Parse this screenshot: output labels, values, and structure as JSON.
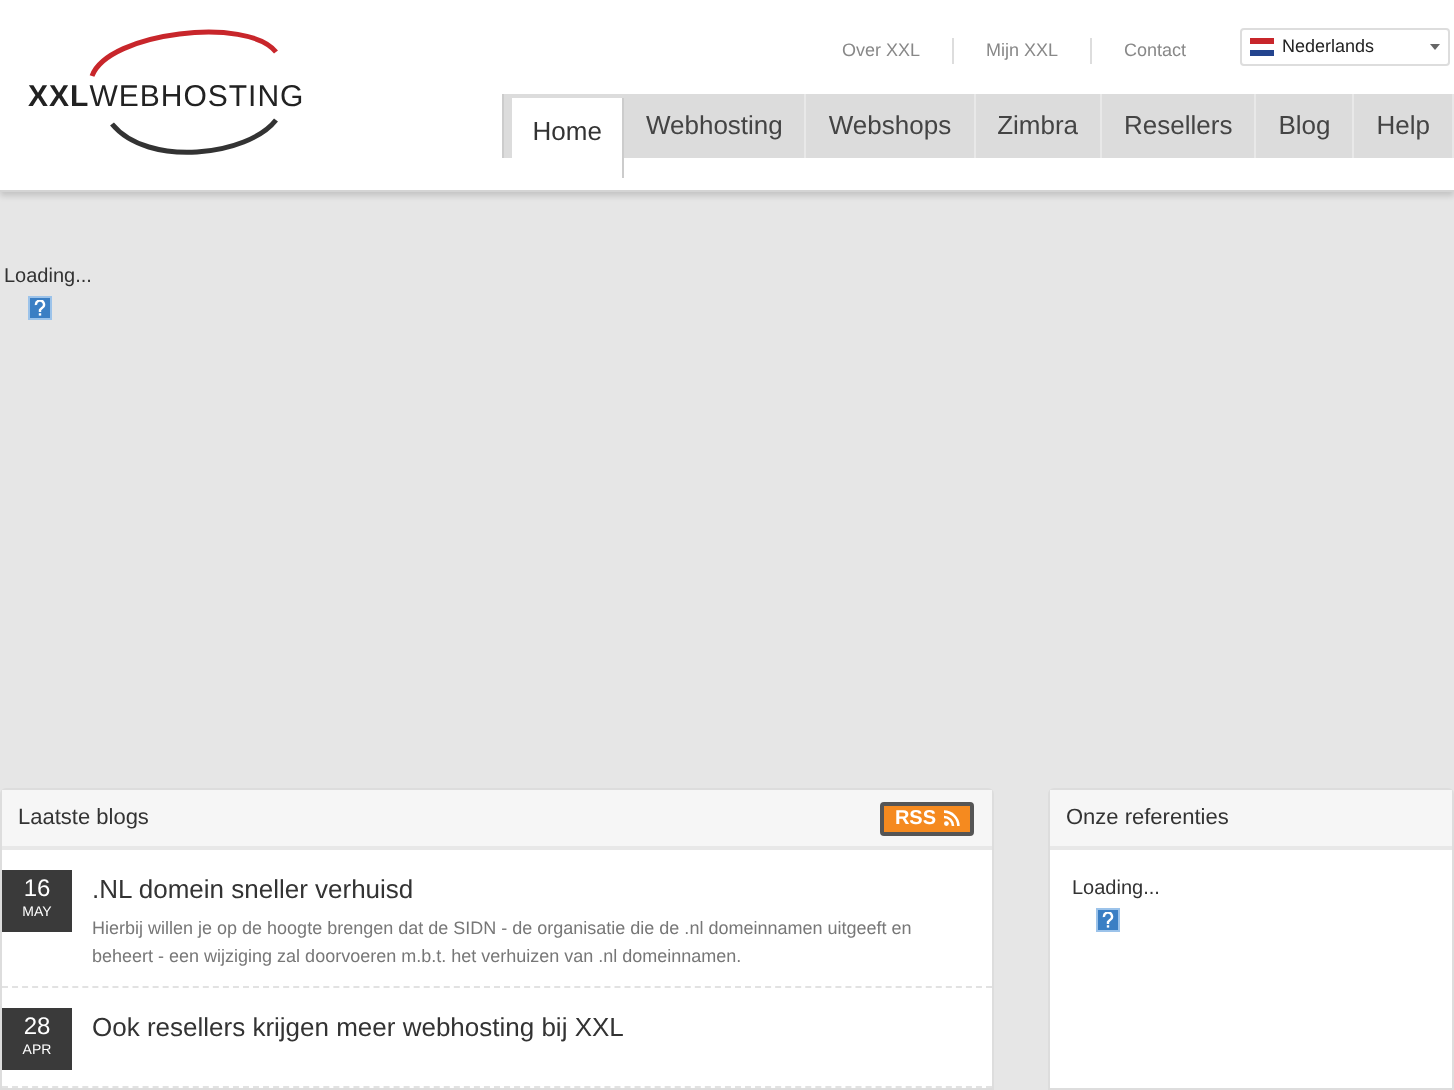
{
  "logo": {
    "text_bold": "XXL",
    "text": "WEBHOSTING"
  },
  "top_links": [
    "Over XXL",
    "Mijn XXL",
    "Contact"
  ],
  "language": {
    "value": "Nederlands"
  },
  "nav": [
    {
      "label": "Home",
      "selected": true
    },
    {
      "label": "Webhosting",
      "selected": false
    },
    {
      "label": "Webshops",
      "selected": false
    },
    {
      "label": "Zimbra",
      "selected": false
    },
    {
      "label": "Resellers",
      "selected": false
    },
    {
      "label": "Blog",
      "selected": false
    },
    {
      "label": "Help",
      "selected": false
    }
  ],
  "banner": {
    "loading": "Loading..."
  },
  "blogs": {
    "title": "Laatste blogs",
    "rss": "RSS",
    "items": [
      {
        "day": "16",
        "month": "MAY",
        "title": ".NL domein sneller verhuisd",
        "excerpt": "Hierbij willen je op de hoogte brengen dat de SIDN - de organisatie die de .nl domeinnamen uitgeeft en beheert - een wijziging zal doorvoeren m.b.t. het verhuizen van .nl domeinnamen."
      },
      {
        "day": "28",
        "month": "APR",
        "title": "Ook resellers krijgen meer webhosting bij XXL"
      }
    ]
  },
  "references": {
    "title": "Onze referenties",
    "loading": "Loading..."
  }
}
